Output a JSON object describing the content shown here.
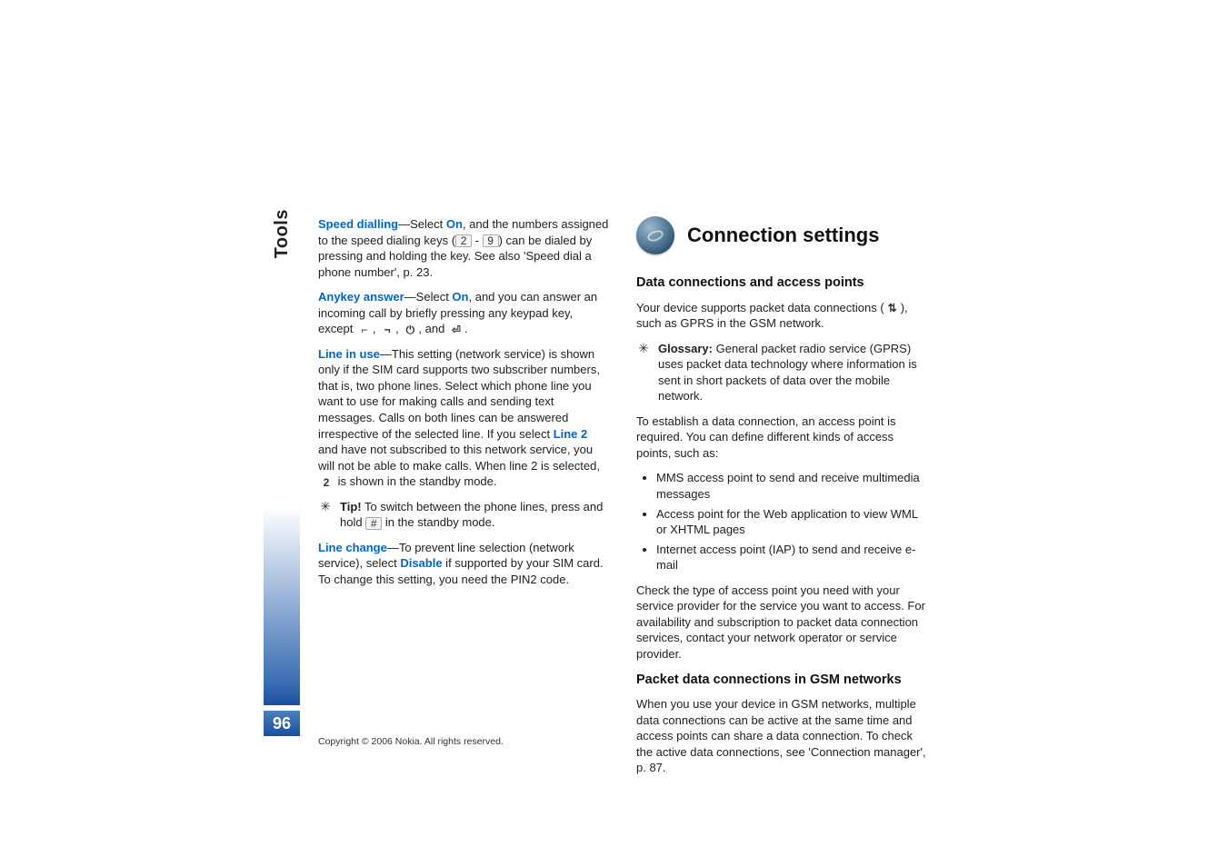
{
  "sidebar": {
    "section": "Tools",
    "page_number": "96"
  },
  "left": {
    "p1a": "Speed dialling",
    "p1b": "—Select ",
    "p1c": "On",
    "p1d": ", and the numbers assigned to the speed dialing keys (",
    "p1e": " - ",
    "p1f": ") can be dialed by pressing and holding the key. See also 'Speed dial a phone number', p. 23.",
    "p2a": "Anykey answer",
    "p2b": "—Select ",
    "p2c": "On",
    "p2d": ", and you can answer an incoming call by briefly pressing any keypad key, except ",
    "p2e": ", ",
    "p2f": ", ",
    "p2g": ", and ",
    "p2h": ".",
    "p3a": "Line in use",
    "p3b": "—This setting (network service) is shown only if the SIM card supports two subscriber numbers, that is, two phone lines. Select which phone line you want to use for making calls and sending text messages. Calls on both lines can be answered irrespective of the selected line. If you select ",
    "p3c": "Line 2",
    "p3d": " and have not subscribed to this network service, you will not be able to make calls. When line 2 is selected, ",
    "p3e": " is shown in the standby mode.",
    "tip_label": "Tip!",
    "tip_text_a": " To switch between the phone lines, press and hold ",
    "tip_text_b": " in the standby mode.",
    "p4a": "Line change",
    "p4b": "—To prevent line selection (network service), select ",
    "p4c": "Disable",
    "p4d": " if supported by your SIM card. To change this setting, you need the PIN2 code."
  },
  "right": {
    "title": "Connection settings",
    "sub1": "Data connections and access points",
    "r1a": "Your device supports packet data connections (",
    "r1b": "), such as GPRS in the GSM network.",
    "gloss_label": "Glossary:",
    "gloss_text": " General packet radio service (GPRS) uses packet data technology where information is sent in short packets of data over the mobile network.",
    "r2": "To establish a data connection, an access point is required. You can define different kinds of access points, such as:",
    "bullets": [
      "MMS access point to send and receive multimedia messages",
      "Access point for the Web application to view WML or XHTML pages",
      "Internet access point (IAP) to send and receive e-mail"
    ],
    "r3": "Check the type of access point you need with your service provider for the service you want to access. For availability and subscription to packet data connection services, contact your network operator or service provider.",
    "sub2": "Packet data connections in GSM networks",
    "r4": "When you use your device in GSM networks, multiple data connections can be active at the same time and access points can share a data connection. To check the active data connections, see 'Connection manager', p. 87."
  },
  "footer": {
    "copyright": "Copyright © 2006 Nokia. All rights reserved."
  },
  "glyphs": {
    "key2": "2",
    "key9": "9",
    "softleft": "⌐",
    "softright": "¬",
    "power": "⏻",
    "end": "⏎",
    "line2": "2",
    "hash": "#",
    "gprs": "⇅"
  }
}
